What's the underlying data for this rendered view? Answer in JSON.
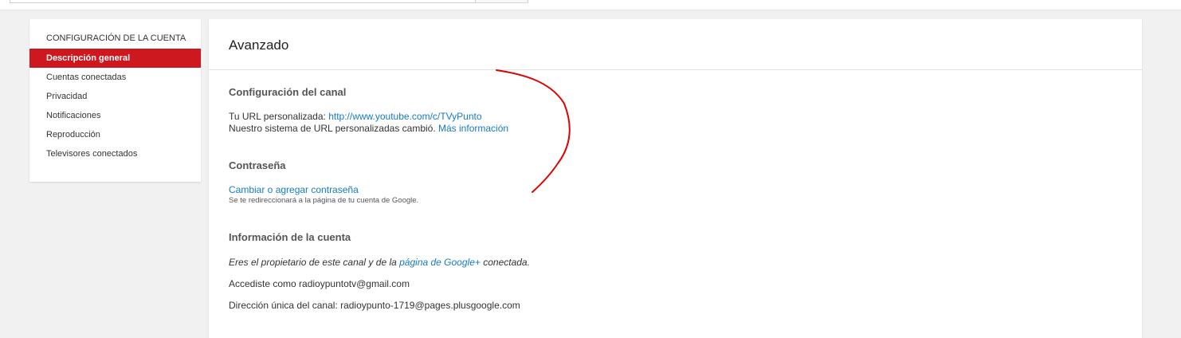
{
  "sidebar": {
    "heading": "CONFIGURACIÓN DE LA CUENTA",
    "items": [
      {
        "label": "Descripción general",
        "active": true
      },
      {
        "label": "Cuentas conectadas",
        "active": false
      },
      {
        "label": "Privacidad",
        "active": false
      },
      {
        "label": "Notificaciones",
        "active": false
      },
      {
        "label": "Reproducción",
        "active": false
      },
      {
        "label": "Televisores conectados",
        "active": false
      }
    ]
  },
  "main": {
    "title": "Avanzado",
    "channel": {
      "title": "Configuración del canal",
      "url_prefix": "Tu URL personalizada: ",
      "url_link": "http://www.youtube.com/c/TVyPunto",
      "system_text": "Nuestro sistema de URL personalizadas cambió. ",
      "more_info_link": "Más información"
    },
    "password": {
      "title": "Contraseña",
      "change_link": "Cambiar o agregar contraseña",
      "note": "Se te redireccionará a la página de tu cuenta de Google."
    },
    "account": {
      "title": "Información de la cuenta",
      "owner_prefix": "Eres el propietario de este canal y de la ",
      "owner_link": "página de Google+",
      "owner_suffix": " conectada.",
      "signed_in": "Accediste como radioypuntotv@gmail.com",
      "unique_address": "Dirección única del canal: radioypunto-1719@pages.plusgoogle.com"
    }
  },
  "colors": {
    "accent_red": "#cc181e",
    "link_blue": "#167ac6",
    "annotation_red": "#e00000"
  }
}
